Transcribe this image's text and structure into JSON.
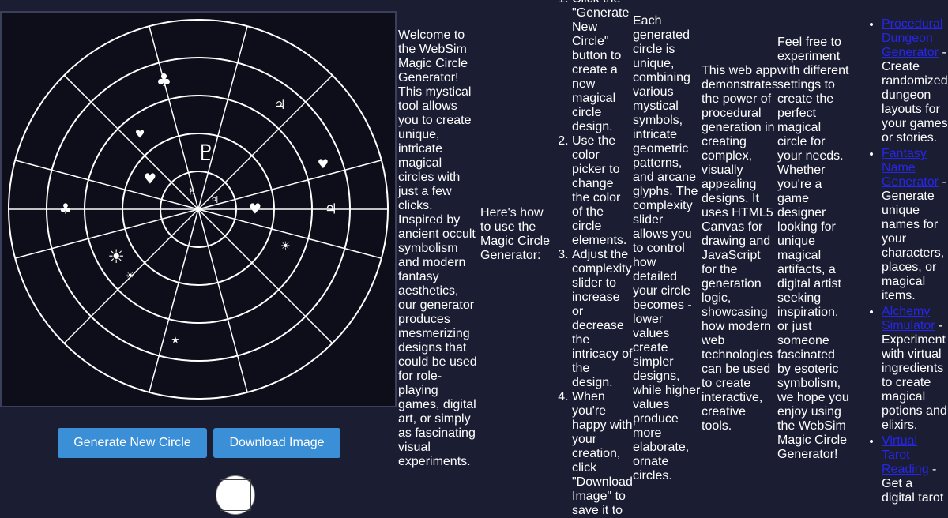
{
  "canvas": {
    "stroke_color": "#ffffff",
    "background": "#0d0e1a",
    "spokes": 12,
    "rings": 5,
    "symbols": [
      {
        "glyph": "♣",
        "ring": 4,
        "angle_deg": -105,
        "size": 22
      },
      {
        "glyph": "♃",
        "ring": 4,
        "angle_deg": -52,
        "size": 16
      },
      {
        "glyph": "♥",
        "ring": 4,
        "angle_deg": -20,
        "size": 16
      },
      {
        "glyph": "♃",
        "ring": 4,
        "angle_deg": 0,
        "size": 18
      },
      {
        "glyph": "☀",
        "ring": 3,
        "angle_deg": 23,
        "size": 14
      },
      {
        "glyph": "♣",
        "ring": 4,
        "angle_deg": 180,
        "size": 18
      },
      {
        "glyph": "☀",
        "ring": 3,
        "angle_deg": 150,
        "size": 24
      },
      {
        "glyph": "☀",
        "ring": 3,
        "angle_deg": 136,
        "size": 12
      },
      {
        "glyph": "★",
        "ring": 4,
        "angle_deg": 100,
        "size": 12
      },
      {
        "glyph": "♥",
        "ring": 3,
        "angle_deg": -128,
        "size": 14
      },
      {
        "glyph": "♥",
        "ring": 2,
        "angle_deg": -148,
        "size": 18
      },
      {
        "glyph": "♇",
        "ring": 2,
        "angle_deg": -82,
        "size": 28
      },
      {
        "glyph": "♄",
        "ring": 1,
        "angle_deg": -110,
        "size": 12
      },
      {
        "glyph": "♃",
        "ring": 1,
        "angle_deg": -30,
        "size": 12
      },
      {
        "glyph": "♥",
        "ring": 2,
        "angle_deg": 0,
        "size": 18
      }
    ]
  },
  "buttons": {
    "generate_label": "Generate New Circle",
    "download_label": "Download Image"
  },
  "color_picker": {
    "value": "#ffffff"
  },
  "intro": {
    "welcome": "Welcome to the WebSim Magic Circle Generator! This mystical tool allows you to create unique, intricate magical circles with just a few clicks. Inspired by ancient occult symbolism and modern fantasy aesthetics, our generator produces mesmerizing designs that could be used for role-playing games, digital art, or simply as fascinating visual experiments."
  },
  "howto": {
    "heading": "Here's how to use the Magic Circle Generator:",
    "steps": [
      "Click the \"Generate New Circle\" button to create a new magical circle design.",
      "Use the color picker to change the color of the circle elements.",
      "Adjust the complexity slider to increase or decrease the intricacy of the design.",
      "When you're happy with your creation, click \"Download Image\" to save it to"
    ]
  },
  "unique": {
    "text": "Each generated circle is unique, combining various mystical symbols, intricate geometric patterns, and arcane glyphs. The complexity slider allows you to control how detailed your circle becomes - lower values create simpler designs, while higher values produce more elaborate, ornate circles."
  },
  "tech": {
    "text": "This web app demonstrates the power of procedural generation in creating complex, visually appealing designs. It uses HTML5 Canvas for drawing and JavaScript for the generation logic, showcasing how modern web technologies can be used to create interactive, creative tools."
  },
  "outro": {
    "text": "Feel free to experiment with different settings to create the perfect magical circle for your needs. Whether you're a game designer looking for unique magical artifacts, a digital artist seeking inspiration, or just someone fascinated by esoteric symbolism, we hope you enjoy using the WebSim Magic Circle Generator!"
  },
  "links": [
    {
      "label": "Procedural Dungeon Generator",
      "desc": " - Create randomized dungeon layouts for your games or stories."
    },
    {
      "label": "Fantasy Name Generator",
      "desc": " - Generate unique names for your characters, places, or magical items."
    },
    {
      "label": "Alchemy Simulator",
      "desc": " - Experiment with virtual ingredients to create magical potions and elixirs."
    },
    {
      "label": "Virtual Tarot Reading",
      "desc": " - Get a digital tarot"
    }
  ]
}
